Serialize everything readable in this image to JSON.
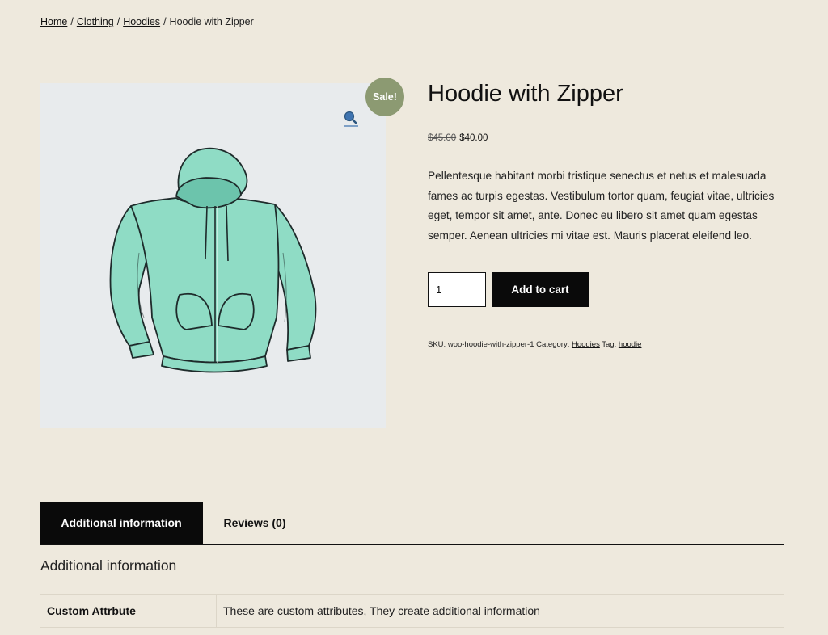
{
  "breadcrumb": {
    "home": "Home",
    "clothing": "Clothing",
    "hoodies": "Hoodies",
    "separator": "/",
    "current": "Hoodie with Zipper"
  },
  "product": {
    "title": "Hoodie with Zipper",
    "sale_badge": "Sale!",
    "price_old": "$45.00",
    "price_new": "$40.00",
    "description": "Pellentesque habitant morbi tristique senectus et netus et malesuada fames ac turpis egestas. Vestibulum tortor quam, feugiat vitae, ultricies eget, tempor sit amet, ante. Donec eu libero sit amet quam egestas semper. Aenean ultricies mi vitae est. Mauris placerat eleifend leo.",
    "quantity": "1",
    "add_to_cart": "Add to cart",
    "zoom_icon": "magnifier-icon",
    "image": "hoodie-image"
  },
  "meta": {
    "sku_label": "SKU:",
    "sku": "woo-hoodie-with-zipper-1",
    "category_label": "Category:",
    "category": "Hoodies",
    "tag_label": "Tag:",
    "tag": "hoodie"
  },
  "tabs": [
    {
      "label": "Additional information"
    },
    {
      "label": "Reviews (0)"
    }
  ],
  "additional": {
    "title": "Additional information",
    "rows": [
      {
        "label": "Custom Attrbute",
        "value": "These are custom attributes, They create additional information"
      }
    ]
  },
  "colors": {
    "background": "#eee9dd",
    "image_bg": "#e8ebed",
    "sale_badge": "#8c9a72",
    "hoodie": "#8fdcc5",
    "button": "#0a0a0a",
    "zoom_icon": "#3f74b0"
  }
}
